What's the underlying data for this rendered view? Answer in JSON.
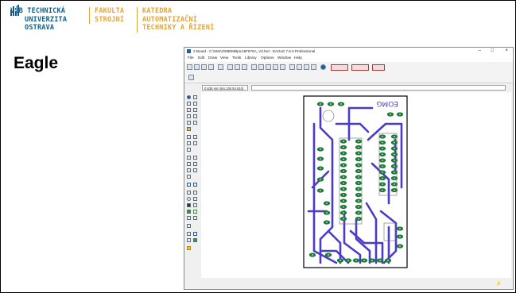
{
  "logo": {
    "line1": "VŠB TECHNICKÁ",
    "line2": "UNIVERZITA",
    "line3": "OSTRAVA",
    "faculty_line1": "FAKULTA",
    "faculty_line2": "STROJNÍ",
    "dept_line1": "KATEDRA",
    "dept_line2": "AUTOMATIZAČNÍ",
    "dept_line3": "TECHNIKY A ŘÍZENÍ",
    "colors": {
      "primary": "#0e5f8f",
      "accent": "#e5a43a"
    }
  },
  "slide": {
    "title": "Eagle"
  },
  "window": {
    "title": "2 Board - C:\\SMAZ\\MB\\MBpic16F876A_V3.brd - EAGLE 7.6.0 Professional",
    "controls": {
      "minimize": "–",
      "maximize": "□",
      "close": "×"
    },
    "menu": [
      "File",
      "Edit",
      "Draw",
      "View",
      "Tools",
      "Library",
      "Options",
      "Window",
      "Help"
    ],
    "coords": "0.635 mm (64.135 54.610)",
    "colors": {
      "board_outline": "#000000",
      "trace": "#4a3cc8",
      "pad": "#1f7a3a",
      "pad_hole": "#cfe8cf",
      "silk": "#5a5a5a"
    }
  },
  "board": {
    "label": "EOMG"
  },
  "status": {
    "icon": "lightning-icon"
  }
}
